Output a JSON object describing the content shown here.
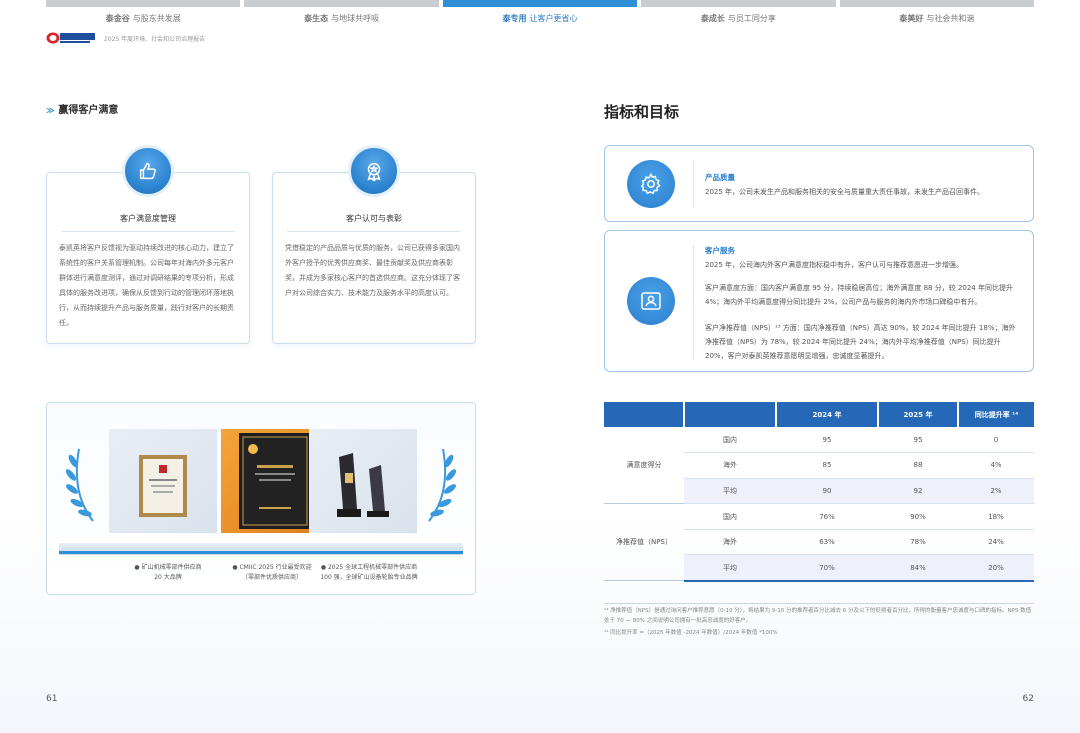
{
  "tabs": [
    {
      "bold": "泰金谷",
      "rest": "与股东共发展",
      "active": false
    },
    {
      "bold": "泰生态",
      "rest": "与地球共呼吸",
      "active": false
    },
    {
      "bold": "泰专用",
      "rest": "让客户更省心",
      "active": true
    },
    {
      "bold": "泰成长",
      "rest": "与员工同分享",
      "active": false
    },
    {
      "bold": "泰美好",
      "rest": "与社会共和谐",
      "active": false
    }
  ],
  "header": {
    "logo_text": "泰凯英轮胎",
    "logo_sub": "TECHKING",
    "report_title": "2025 年度环境、社会和公司治理报告"
  },
  "left": {
    "section_title": "赢得客户满意",
    "cards": [
      {
        "title": "客户满意度管理",
        "body": "泰凯英将客户反馈视为驱动持续改进的核心动力，建立了系统性的客户关系管理机制。公司每年对海内外多元客户群体进行满意度测评，通过对调研结果的专项分析，形成具体的服务改进项，确保从反馈到行动的管理闭环落地执行，从而持续提升产品与服务质量，践行对客户的长期责任。",
        "icon": "thumbs-up-icon"
      },
      {
        "title": "客户认可与表彰",
        "body": "凭借稳定的产品品质与优质的服务，公司已获得多家国内外客户授予的优秀供应商奖、最佳贡献奖及供应商表彰奖，并成为多家核心客户的首选供应商。这充分体现了客户对公司综合实力、技术能力及服务水平的高度认可。",
        "icon": "medal-icon"
      }
    ],
    "awards": [
      {
        "caption_line1": "● 矿山机械零部件供应商",
        "caption_line2": "20 大品牌"
      },
      {
        "caption_line1": "● CMIIC 2025 行业最受欢迎",
        "caption_line2": "（零部件优质供应商）"
      },
      {
        "caption_line1": "● 2025 全球工程机械零部件供应商",
        "caption_line2": "100 强，全球矿山设备轮胎专业品牌"
      }
    ],
    "page_number": "61"
  },
  "right": {
    "title": "指标和目标",
    "quality": {
      "heading": "产品质量",
      "body": "2025 年，公司未发生产品和服务相关的安全与质量重大责任事故，未发生产品召回事件。",
      "icon": "gear-icon"
    },
    "service": {
      "heading": "客户服务",
      "p1": "2025 年，公司海内外客户满意度指标稳中有升，客户认可与推荐意愿进一步增强。",
      "p2": "客户满意度方面：国内客户满意度 95 分，持续稳居高位；海外满意度 88 分，较 2024 年同比提升 4%；海内外平均满意度得分同比提升 2%，公司产品与服务的海内外市场口碑稳中有升。",
      "p3": "客户净推荐值（NPS）¹³ 方面：国内净推荐值（NPS）高达 90%，较 2024 年同比提升 18%；海外净推荐值（NPS）为 78%，较 2024 年同比提升 24%；海内外平均净推荐值（NPS）同比提升 20%，客户对泰凯英推荐意愿明显增强，忠诚度显著提升。",
      "icon": "user-group-icon"
    },
    "table": {
      "headers": [
        "",
        "",
        "2024 年",
        "2025 年",
        "同比提升率 ¹⁴"
      ],
      "groups": [
        {
          "name": "满意度得分",
          "rows": [
            [
              "国内",
              "95",
              "95",
              "0"
            ],
            [
              "海外",
              "85",
              "88",
              "4%"
            ],
            [
              "平均",
              "90",
              "92",
              "2%"
            ]
          ]
        },
        {
          "name": "净推荐值（NPS）",
          "rows": [
            [
              "国内",
              "76%",
              "90%",
              "18%"
            ],
            [
              "海外",
              "63%",
              "78%",
              "24%"
            ],
            [
              "平均",
              "70%",
              "84%",
              "20%"
            ]
          ]
        }
      ]
    },
    "notes": [
      "¹³ 净推荐值（NPS）是通过询问客户推荐意愿（0-10 分），将结果为 9-10 分的推荐者百分比减去 6 分及以下的贬损者百分比，所得的衡量客户忠诚度与口碑的指标。NPS 数值处于 70 — 80% 之间说明公司拥有一批高忠诚度的好客户。",
      "¹⁴ 同比提升率 =（2025 年数值 -2024 年数值）/2024 年数值 *100%"
    ],
    "page_number": "62"
  },
  "colors": {
    "accent": "#2f8fd6",
    "table_header": "#2568b8",
    "tab_active": "#2f8fd6",
    "tab_inactive": "#c9ccd1"
  }
}
